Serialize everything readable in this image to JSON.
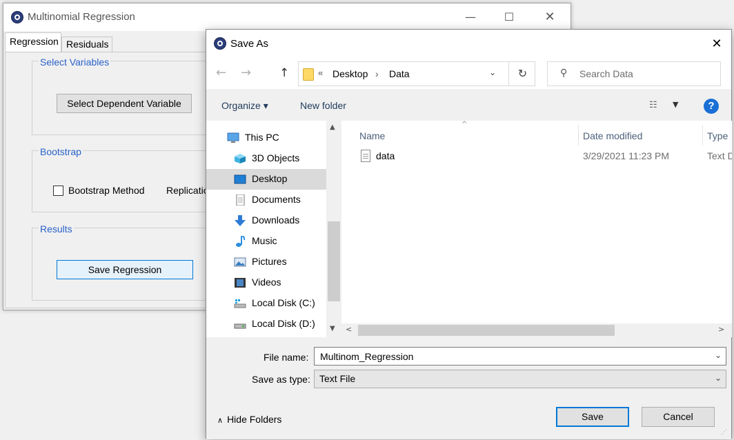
{
  "main_window": {
    "title": "Multinomial Regression",
    "controls": {
      "minimize": "—",
      "maximize": "☐",
      "close": "✕"
    },
    "tabs": [
      {
        "label": "Regression",
        "active": true
      },
      {
        "label": "Residuals",
        "active": false
      }
    ],
    "groups": {
      "select_variables": {
        "title": "Select Variables",
        "button": "Select Dependent Variable"
      },
      "bootstrap": {
        "title": "Bootstrap",
        "checkbox_label": "Bootstrap Method",
        "checked": false,
        "replication_label": "Replications"
      },
      "results": {
        "title": "Results",
        "button": "Save Regression"
      }
    },
    "accent_color": "#2a62c9"
  },
  "dialog": {
    "title": "Save As",
    "close": "✕",
    "nav": {
      "back": "←",
      "forward": "→",
      "up": "↑"
    },
    "address": {
      "chevron": "«",
      "crumbs": [
        "Desktop",
        "Data"
      ],
      "separator": "›",
      "dropdown": "⌄",
      "refresh": "↻"
    },
    "search": {
      "placeholder": "Search Data",
      "icon": "⚲"
    },
    "toolbar": {
      "organize": "Organize ▾",
      "new_folder": "New folder",
      "view_icon": "☷",
      "view_dropdown": "▼",
      "help": "?"
    },
    "nav_pane": {
      "items": [
        {
          "label": "This PC",
          "icon": "monitor-icon"
        },
        {
          "label": "3D Objects",
          "icon": "cube-icon"
        },
        {
          "label": "Desktop",
          "icon": "desktop-icon",
          "selected": true
        },
        {
          "label": "Documents",
          "icon": "document-icon"
        },
        {
          "label": "Downloads",
          "icon": "download-icon"
        },
        {
          "label": "Music",
          "icon": "music-icon"
        },
        {
          "label": "Pictures",
          "icon": "picture-icon"
        },
        {
          "label": "Videos",
          "icon": "video-icon"
        },
        {
          "label": "Local Disk (C:)",
          "icon": "drive-icon"
        },
        {
          "label": "Local Disk (D:)",
          "icon": "drive-icon"
        }
      ],
      "scroll_up": "▲",
      "scroll_down": "▼"
    },
    "file_list": {
      "columns": {
        "name": "Name",
        "date": "Date modified",
        "type": "Type"
      },
      "sort_caret": "^",
      "rows": [
        {
          "name": "data",
          "date": "3/29/2021 11:23 PM",
          "type": "Text Document"
        }
      ],
      "scroll_left": "<",
      "scroll_right": ">"
    },
    "form": {
      "filename_label": "File name:",
      "filename_value": "Multinom_Regression",
      "savetype_label": "Save as type:",
      "savetype_value": "Text File",
      "combo_arrow": "⌄"
    },
    "hide_folders": {
      "icon": "∧",
      "label": "Hide Folders"
    },
    "buttons": {
      "save": "Save",
      "cancel": "Cancel"
    },
    "resize_grip": "⋰"
  }
}
